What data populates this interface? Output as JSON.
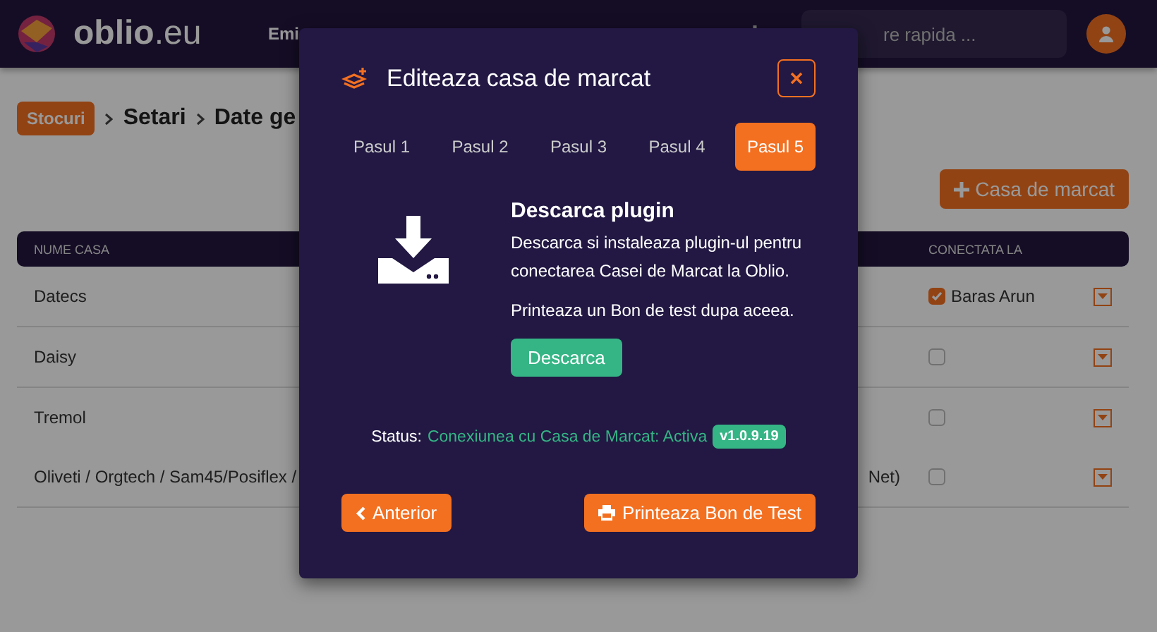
{
  "header": {
    "logo": "**oblio**.eu",
    "nav": [
      "Emi"
    ],
    "search": {
      "placeholder": "re rapida ..."
    }
  },
  "breadcrumb": {
    "badge": "Stocuri",
    "items": [
      "Setari",
      "Date ge"
    ]
  },
  "add_button": "Casa de marcat",
  "table": {
    "columns": [
      "NUME CASA",
      "CONECTATA LA"
    ],
    "rows": [
      {
        "name": "Datecs",
        "name_tail": "",
        "checked": true,
        "connected_to": "Baras Arun"
      },
      {
        "name": "Daisy",
        "name_tail": "",
        "checked": false,
        "connected_to": ""
      },
      {
        "name": "Tremol",
        "name_tail": "",
        "checked": false,
        "connected_to": ""
      },
      {
        "name": "Oliveti / Orgtech / Sam45/Posiflex /",
        "name_tail": "Net)",
        "checked": false,
        "connected_to": ""
      }
    ]
  },
  "modal": {
    "title": "Editeaza casa de marcat",
    "tabs": [
      {
        "label": "Pasul 1",
        "selected": false
      },
      {
        "label": "Pasul 2",
        "selected": false
      },
      {
        "label": "Pasul 3",
        "selected": false
      },
      {
        "label": "Pasul 4",
        "selected": false
      },
      {
        "label": "Pasul 5",
        "selected": true
      }
    ],
    "heading": "Descarca plugin",
    "paragraphs": [
      "Descarca si instaleaza plugin-ul pentru conectarea Casei de Marcat la Oblio.",
      "Printeaza un Bon de test dupa aceea."
    ],
    "download_button": "Descarca",
    "status_label": "Status:",
    "status_value": "Conexiunea cu Casa de Marcat: Activa",
    "version": "v1.0.9.19",
    "back_button": "Anterior",
    "print_button": "Printeaza Bon de Test"
  }
}
